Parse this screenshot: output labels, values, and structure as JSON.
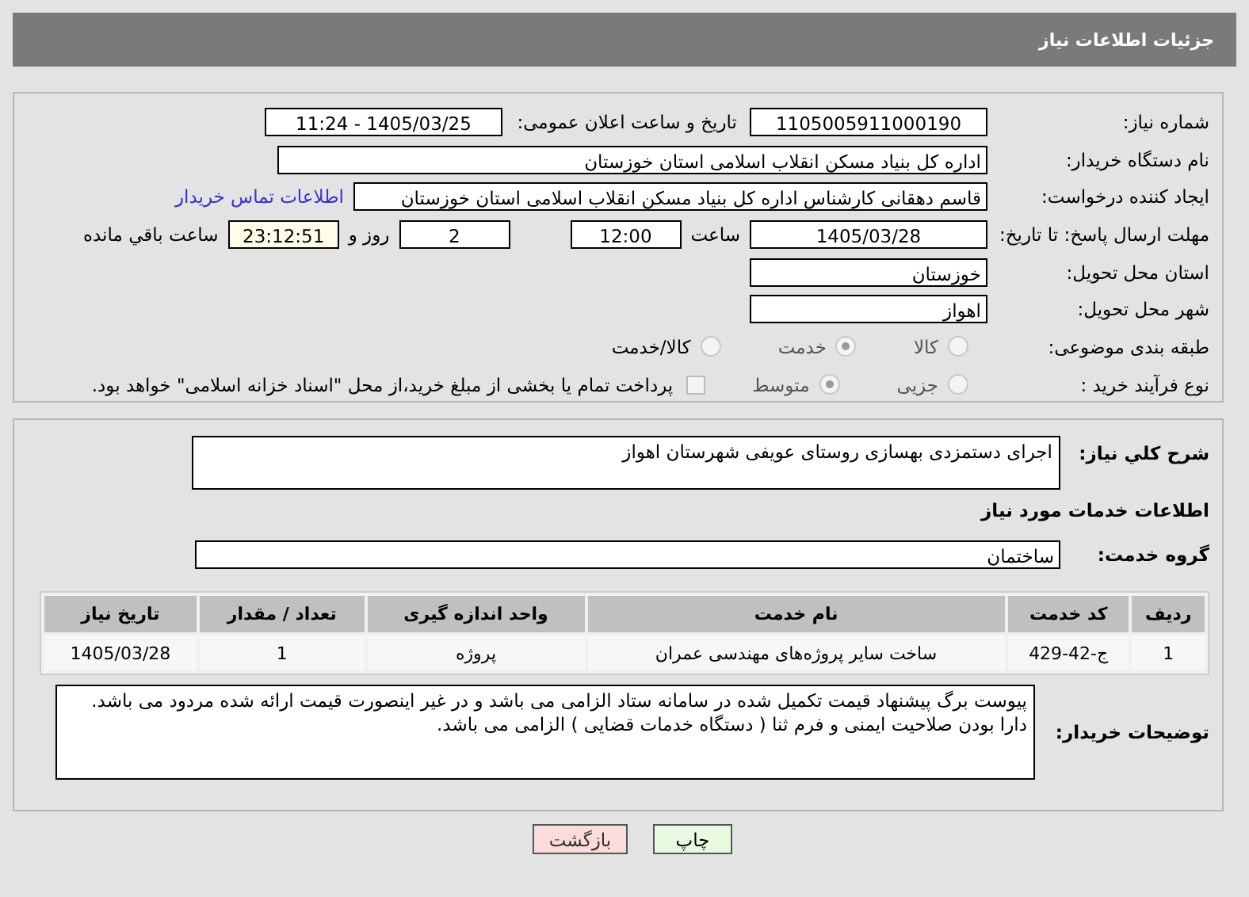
{
  "header": {
    "title": "جزئیات اطلاعات نیاز"
  },
  "need_number": {
    "label": "شماره نیاز:",
    "value": "1105005911000190"
  },
  "announce": {
    "label": "تاریخ و ساعت اعلان عمومی:",
    "value": "1405/03/25 - 11:24"
  },
  "buyer": {
    "label": "نام دستگاه خریدار:",
    "value": "اداره کل بنیاد مسکن انقلاب اسلامی استان خوزستان"
  },
  "creator": {
    "label": "ایجاد کننده درخواست:",
    "value": "قاسم دهقانی کارشناس اداره کل بنیاد مسکن انقلاب اسلامی استان خوزستان",
    "link": "اطلاعات تماس خریدار"
  },
  "deadline": {
    "label": "مهلت ارسال پاسخ: تا تاریخ:",
    "date": "1405/03/28",
    "time_label": "ساعت",
    "time": "12:00",
    "days": "2",
    "days_label": "روز و",
    "remaining": "23:12:51",
    "remaining_label": "ساعت باقي مانده"
  },
  "province": {
    "label": "استان محل تحویل:",
    "value": "خوزستان"
  },
  "city": {
    "label": "شهر محل تحویل:",
    "value": "اهواز"
  },
  "category": {
    "label": "طبقه بندی موضوعی:",
    "options": [
      {
        "label": "کالا",
        "selected": false
      },
      {
        "label": "خدمت",
        "selected": true
      },
      {
        "label": "کالا/خدمت",
        "selected": false
      }
    ]
  },
  "process": {
    "label": "نوع فرآیند خرید :",
    "options": [
      {
        "label": "جزیی",
        "selected": false
      },
      {
        "label": "متوسط",
        "selected": true
      }
    ],
    "treasury": {
      "checked": false,
      "text": "پرداخت تمام یا بخشی از مبلغ خرید،از محل \"اسناد خزانه اسلامی\" خواهد بود."
    }
  },
  "summary": {
    "label": "شرح کلي نیاز:",
    "value": "اجرای دستمزدی بهسازی روستای عویفی شهرستان اهواز"
  },
  "services_title": "اطلاعات خدمات مورد نیاز",
  "service_group": {
    "label": "گروه خدمت:",
    "value": "ساختمان"
  },
  "table": {
    "columns": [
      "ردیف",
      "کد خدمت",
      "نام خدمت",
      "واحد اندازه گیری",
      "تعداد / مقدار",
      "تاریخ نیاز"
    ],
    "rows": [
      [
        "1",
        "ج-42-429",
        "ساخت سایر پروژه‌های مهندسی عمران",
        "پروژه",
        "1",
        "1405/03/28"
      ]
    ]
  },
  "notes": {
    "label": "توضیحات خریدار:",
    "value": "پیوست برگ پیشنهاد قیمت تکمیل شده در سامانه ستاد الزامی می باشد و در غیر اینصورت  قیمت ارائه شده مردود می باشد.\nدارا بودن صلاحیت ایمنی و فرم ثنا ( دستگاه خدمات قضایی ) الزامی می باشد."
  },
  "buttons": [
    {
      "label": "چاپ",
      "kind": "print"
    },
    {
      "label": "بازگشت",
      "kind": "back"
    }
  ]
}
